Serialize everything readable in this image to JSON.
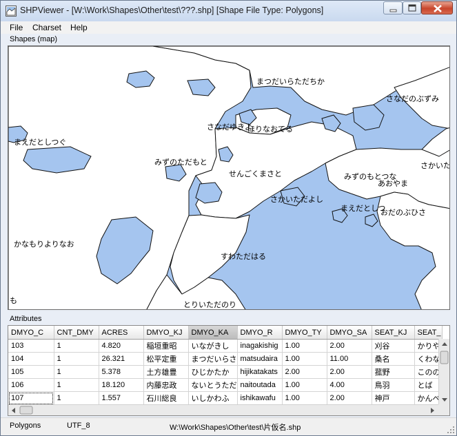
{
  "window": {
    "title": "SHPViewer - [W:\\Work\\Shapes\\Other\\test\\???.shp] [Shape File Type: Polygons]"
  },
  "menu": [
    "File",
    "Charset",
    "Help"
  ],
  "map_panel": {
    "label": "Shapes (map)",
    "land_color": "#ffffff",
    "water_color": "#a5c5ef",
    "labels": [
      "まつだいらただちか",
      "さなだのぶずみ",
      "さなだゆきよ",
      "ほりなおてる",
      "まえだとしつぐ",
      "みずのただもと",
      "せんごくまさと",
      "さかいただ",
      "みずのもとつな",
      "あおやま",
      "さかいただよし",
      "まえだとしつ",
      "おだのぶひさ",
      "かなもりよりなお",
      "すわただはる",
      "とりいただのり",
      "も"
    ]
  },
  "attributes_panel": {
    "label": "Attributes",
    "columns": [
      "DMYO_C",
      "CNT_DMY",
      "ACRES",
      "DMYO_KJ",
      "DMYO_KA",
      "DMYO_R",
      "DMYO_TY",
      "DMYO_SA",
      "SEAT_KJ",
      "SEAT_"
    ],
    "selected_column": "DMYO_KA",
    "rows": [
      [
        "103",
        "1",
        "4.820",
        "稲垣重昭",
        "いながきし",
        "inagakishig",
        "1.00",
        "2.00",
        "刈谷",
        "かりや"
      ],
      [
        "104",
        "1",
        "26.321",
        "松平定重",
        "まつだいらさ",
        "matsudaira",
        "1.00",
        "11.00",
        "桑名",
        "くわな"
      ],
      [
        "105",
        "1",
        "5.378",
        "土方雄豊",
        "ひじかたか",
        "hijikatakats",
        "2.00",
        "2.00",
        "菰野",
        "このの"
      ],
      [
        "106",
        "1",
        "18.120",
        "内藤忠政",
        "ないとうただ",
        "naitoutada",
        "1.00",
        "4.00",
        "鳥羽",
        "とば"
      ],
      [
        "107",
        "1",
        "1.557",
        "石川総良",
        "いしかわふ",
        "ishikawafu",
        "1.00",
        "2.00",
        "神戸",
        "かんべ"
      ]
    ]
  },
  "status": {
    "shape_type": "Polygons",
    "charset": "UTF_8",
    "path": "W:\\Work\\Shapes\\Other\\test\\片仮名.shp"
  }
}
